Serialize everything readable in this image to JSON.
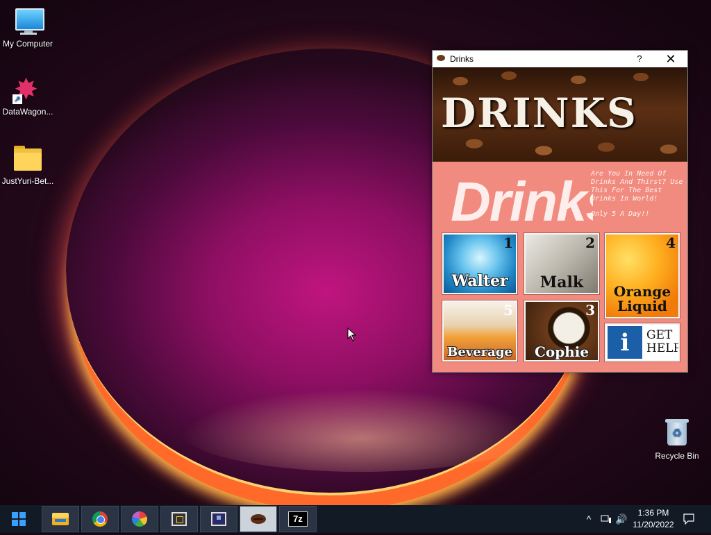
{
  "desktop": {
    "icons": [
      {
        "label": "My Computer"
      },
      {
        "label": "DataWagon..."
      },
      {
        "label": "JustYuri-Bet..."
      },
      {
        "label": "Recycle Bin"
      }
    ]
  },
  "window": {
    "title": "Drinks",
    "help_label": "?",
    "close_label": "✕",
    "banner_title": "DRINKS",
    "big_text": "Drinks",
    "tagline_1": "Are You In Need Of Drinks And Thirst? Use This For The Best Drinks In World!",
    "tagline_2": "Only 5 A Day!!",
    "tiles": [
      {
        "label": "Walter",
        "num": "1"
      },
      {
        "label": "Malk",
        "num": "2"
      },
      {
        "label": "Orange Liquid",
        "num": "4"
      },
      {
        "label": "Beverage",
        "num": "5"
      },
      {
        "label": "Cophie",
        "num": "3"
      },
      {
        "label": "GET HELP",
        "icon_letter": "i"
      }
    ]
  },
  "taskbar": {
    "apps": [
      "start",
      "file-explorer",
      "chrome",
      "paint",
      "monitor-app",
      "screen-app",
      "drinks",
      "7zip"
    ],
    "sevenzip_label": "7z",
    "tray": {
      "chevron": "^",
      "volume": "🔊"
    },
    "clock": {
      "time": "1:36 PM",
      "date": "11/20/2022"
    }
  },
  "colors": {
    "window_bg": "#f28b7f",
    "taskbar_bg": "#121a26",
    "accent": "#3aa0ff"
  }
}
